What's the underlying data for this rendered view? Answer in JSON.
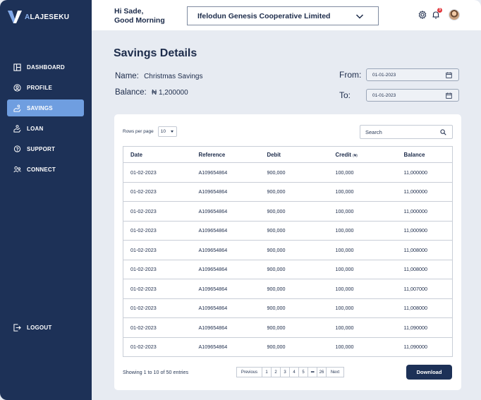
{
  "brand": {
    "initial": "A",
    "rest": "LAJESEKU"
  },
  "sidebar": {
    "items": [
      {
        "label": "DASHBOARD",
        "icon": "dashboard-icon"
      },
      {
        "label": "PROFILE",
        "icon": "profile-icon"
      },
      {
        "label": "SAVINGS",
        "icon": "savings-icon",
        "active": true
      },
      {
        "label": "LOAN",
        "icon": "loan-icon"
      },
      {
        "label": "SUPPORT",
        "icon": "support-icon"
      },
      {
        "label": "CONNECT",
        "icon": "connect-icon"
      }
    ],
    "logout": {
      "label": "LOGOUT",
      "icon": "logout-icon"
    }
  },
  "header": {
    "greeting_line1": "Hi Sade,",
    "greeting_line2": "Good Morning",
    "cooperative": "Ifelodun Genesis Cooperative Limited",
    "notification_count": "3"
  },
  "page": {
    "title": "Savings Details",
    "name_label": "Name:",
    "name_value": "Christmas Savings",
    "balance_label": "Balance:",
    "balance_value": "₦ 1,200000",
    "from_label": "From:",
    "from_value": "01-01-2023",
    "to_label": "To:",
    "to_value": "01-01-2023"
  },
  "table": {
    "rows_per_page_label": "Rows per page",
    "rows_per_page": "10",
    "search_placeholder": "Search",
    "headers": {
      "date": "Date",
      "reference": "Reference",
      "debit": "Debit",
      "credit": "Credit",
      "credit_unit": "(₦)",
      "balance": "Balance"
    },
    "rows": [
      {
        "date": "01-02-2023",
        "reference": "A109654864",
        "debit": "900,000",
        "credit": "100,000",
        "balance": "11,000000"
      },
      {
        "date": "01-02-2023",
        "reference": "A109654864",
        "debit": "900,000",
        "credit": "100,000",
        "balance": "11,000000"
      },
      {
        "date": "01-02-2023",
        "reference": "A109654864",
        "debit": "900,000",
        "credit": "100,000",
        "balance": "11,000000"
      },
      {
        "date": "01-02-2023",
        "reference": "A109654864",
        "debit": "900,000",
        "credit": "100,000",
        "balance": "11,000900"
      },
      {
        "date": "01-02-2023",
        "reference": "A109654864",
        "debit": "900,000",
        "credit": "100,000",
        "balance": "11,008000"
      },
      {
        "date": "01-02-2023",
        "reference": "A109654864",
        "debit": "900,000",
        "credit": "100,000",
        "balance": "11,008000"
      },
      {
        "date": "01-02-2023",
        "reference": "A109654864",
        "debit": "900,000",
        "credit": "100,000",
        "balance": "11,007000"
      },
      {
        "date": "01-02-2023",
        "reference": "A109654864",
        "debit": "900,000",
        "credit": "100,000",
        "balance": "11,008000"
      },
      {
        "date": "01-02-2023",
        "reference": "A109654864",
        "debit": "900,000",
        "credit": "100,000",
        "balance": "11,090000"
      },
      {
        "date": "01-02-2023",
        "reference": "A109654864",
        "debit": "900,000",
        "credit": "100,000",
        "balance": "11,090000"
      }
    ]
  },
  "footer": {
    "showing": "Showing 1 to 10 of 50 entries",
    "pagination": [
      "Previous",
      "1",
      "2",
      "3",
      "4",
      "5",
      "•••",
      "26",
      "Next"
    ],
    "download_label": "Download"
  },
  "colors": {
    "sidebar": "#1d3157",
    "active": "#6f9ee0",
    "background": "#e7ebf2"
  }
}
